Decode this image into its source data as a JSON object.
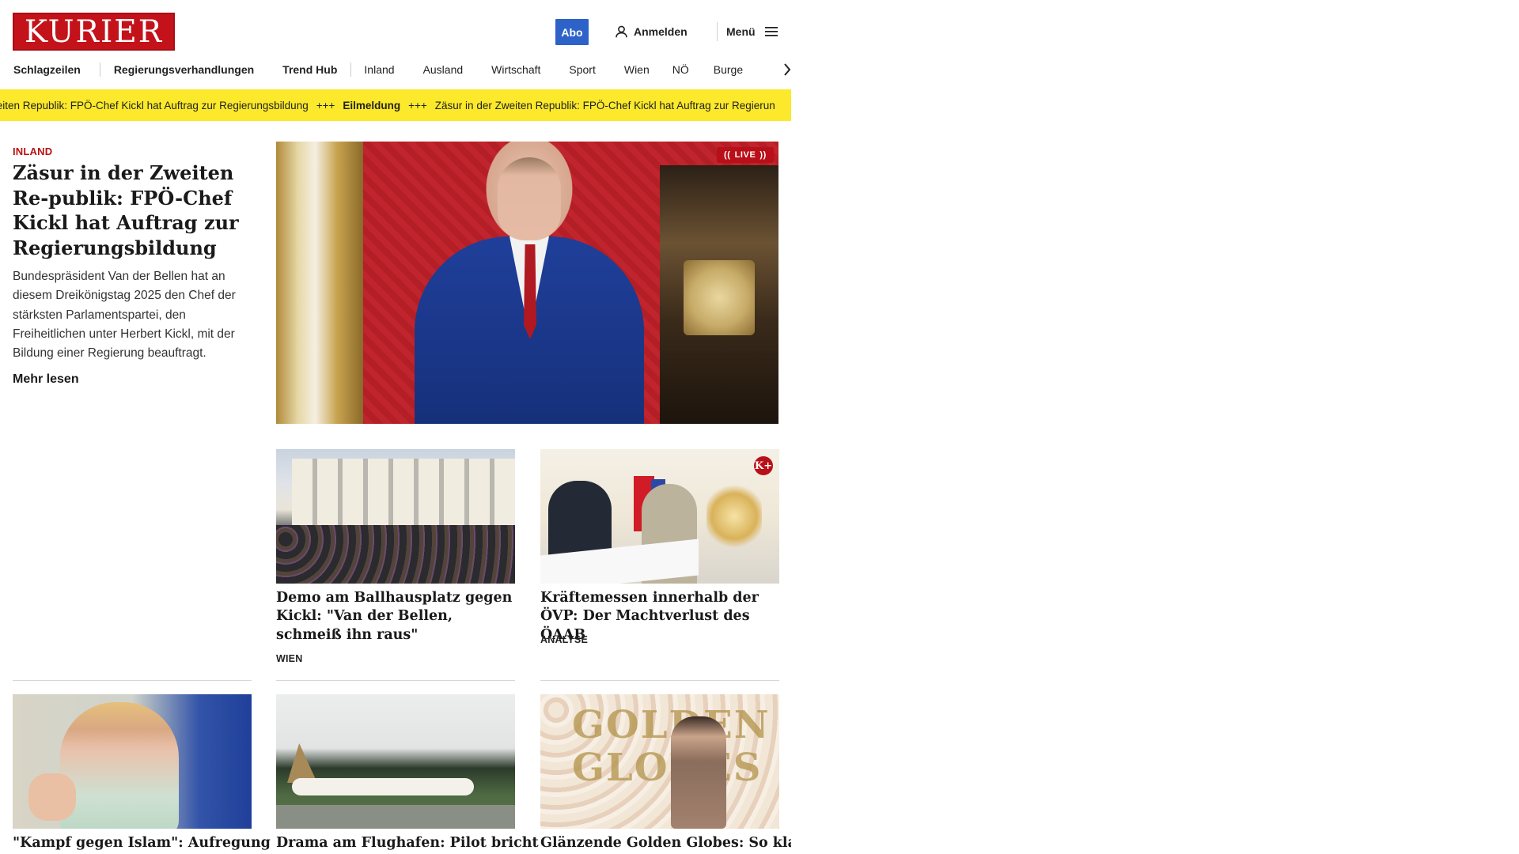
{
  "brand": {
    "logo_text": "KURIER",
    "accent": "#c4121a"
  },
  "header": {
    "abo_label": "Abo",
    "login_label": "Anmelden",
    "menu_label": "Menü"
  },
  "nav": {
    "items": [
      "Schlagzeilen",
      "Regierungsverhandlungen",
      "Trend Hub",
      "Inland",
      "Ausland",
      "Wirtschaft",
      "Sport",
      "Wien",
      "NÖ",
      "Burge"
    ]
  },
  "ticker": {
    "lead_fragment": "weiten Republik: FPÖ-Chef Kickl hat Auftrag zur Regierungsbildung",
    "separator": "+++",
    "label": "Eilmeldung",
    "text": "Zäsur in der Zweiten Republik: FPÖ-Chef Kickl hat Auftrag zur Regierun",
    "background": "#fce92b"
  },
  "lead": {
    "kicker": "INLAND",
    "title": "Zäsur in der Zweiten Re-publik: FPÖ-Chef Kickl hat Auftrag zur Regierungsbildung",
    "teaser": "Bundespräsident Van der Bellen hat an diesem Dreikönigstag 2025 den Chef der stärksten Parlamentspartei, den Freiheitlichen unter Herbert Kickl, mit der Bildung einer Regierung beauftragt.",
    "more": "Mehr lesen",
    "badge": "LIVE"
  },
  "articles": [
    {
      "title": "Demo am Ballhausplatz gegen Kickl: \"Van der Bellen, schmeiß ihn raus\"",
      "tag": "WIEN"
    },
    {
      "title": "Kräftemessen innerhalb der ÖVP: Der Machtverlust des ÖAAB",
      "tag": "ANALYSE",
      "badge": "K+"
    },
    {
      "title": "\"Kampf gegen Islam\": Aufregung"
    },
    {
      "title": "Drama am Flughafen: Pilot bricht"
    },
    {
      "title": "Glänzende Golden Globes: So klas-"
    }
  ],
  "image_texts": {
    "golden_globes": "GOLDEN GLOBES"
  }
}
